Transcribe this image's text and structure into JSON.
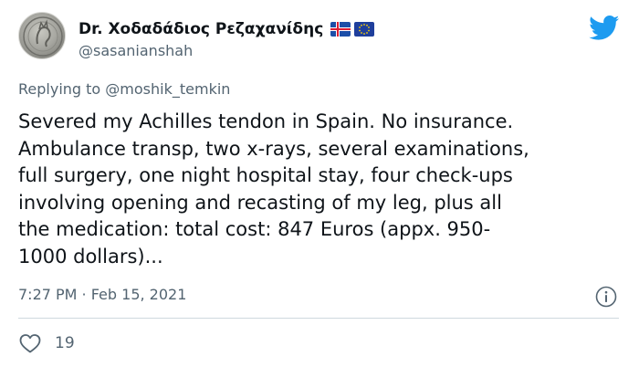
{
  "author": {
    "display_name": "Dr. Χοδαδάδιος Ρεζαχανίδης",
    "handle": "@sasanianshah",
    "flags": [
      "iceland-flag",
      "eu-flag"
    ]
  },
  "reply": {
    "prefix": "Replying to ",
    "mention": "@moshik_temkin"
  },
  "tweet": {
    "text": "Severed my Achilles tendon in Spain. No insurance.\nAmbulance transp, two x-rays, several examinations,\nfull surgery, one night hospital stay, four check-ups\ninvolving opening and recasting of my leg, plus all\nthe medication: total cost: 847 Euros (appx. 950-\n1000 dollars)...",
    "timestamp": "7:27 PM · Feb 15, 2021",
    "likes": "19"
  },
  "colors": {
    "twitter_blue": "#1d9bf0",
    "secondary_text": "#536471",
    "divider": "#cfd9de"
  },
  "icons": {
    "brand": "twitter-bird-icon",
    "info": "info-icon",
    "like": "heart-icon"
  }
}
